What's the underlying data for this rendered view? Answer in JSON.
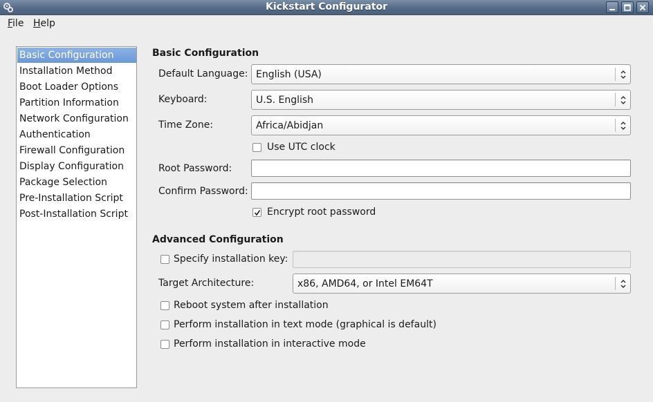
{
  "window": {
    "title": "Kickstart Configurator"
  },
  "menu": {
    "file": {
      "mnemonic": "F",
      "rest": "ile"
    },
    "help": {
      "mnemonic": "H",
      "rest": "elp"
    }
  },
  "sidebar": {
    "items": [
      "Basic Configuration",
      "Installation Method",
      "Boot Loader Options",
      "Partition Information",
      "Network Configuration",
      "Authentication",
      "Firewall Configuration",
      "Display Configuration",
      "Package Selection",
      "Pre-Installation Script",
      "Post-Installation Script"
    ],
    "selected_index": 0,
    "selection_color": "#7aa3de"
  },
  "basic": {
    "heading": "Basic Configuration",
    "default_language": {
      "label": "Default Language:",
      "value": "English (USA)"
    },
    "keyboard": {
      "label": "Keyboard:",
      "value": "U.S. English"
    },
    "time_zone": {
      "label": "Time Zone:",
      "value": "Africa/Abidjan"
    },
    "utc_clock": {
      "label": "Use UTC clock",
      "checked": false
    },
    "root_password": {
      "label": "Root Password:",
      "value": ""
    },
    "confirm_password": {
      "label": "Confirm Password:",
      "value": ""
    },
    "encrypt_root": {
      "label": "Encrypt root password",
      "checked": true
    }
  },
  "advanced": {
    "heading": "Advanced Configuration",
    "install_key": {
      "label": "Specify installation key:",
      "checked": false,
      "value": ""
    },
    "target_arch": {
      "label": "Target Architecture:",
      "value": "x86, AMD64, or Intel EM64T"
    },
    "reboot": {
      "label": "Reboot system after installation",
      "checked": false
    },
    "text_mode": {
      "label": "Perform installation in text mode (graphical is default)",
      "checked": false
    },
    "interactive": {
      "label": "Perform installation in interactive mode",
      "checked": false
    }
  },
  "colors": {
    "titlebar": "#5f7492",
    "window_bg": "#ededed"
  }
}
